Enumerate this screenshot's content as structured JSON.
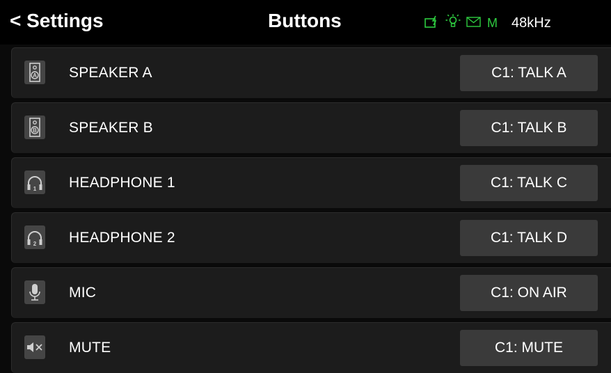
{
  "header": {
    "back_label": "< Settings",
    "title": "Buttons",
    "status": {
      "icons": [
        "battery-charging-icon",
        "light-bulb-icon",
        "mail-icon"
      ],
      "mode_letter": "M",
      "sample_rate": "48kHz",
      "accent_color": "#2ecc40"
    }
  },
  "rows": [
    {
      "icon": "speaker-a-icon",
      "label": "SPEAKER A",
      "assignment": "C1: TALK A"
    },
    {
      "icon": "speaker-b-icon",
      "label": "SPEAKER B",
      "assignment": "C1: TALK B"
    },
    {
      "icon": "headphone-1-icon",
      "label": "HEADPHONE 1",
      "assignment": "C1: TALK C"
    },
    {
      "icon": "headphone-2-icon",
      "label": "HEADPHONE 2",
      "assignment": "C1: TALK D"
    },
    {
      "icon": "mic-icon",
      "label": "MIC",
      "assignment": "C1: ON AIR"
    },
    {
      "icon": "mute-icon",
      "label": "MUTE",
      "assignment": "C1: MUTE"
    }
  ]
}
